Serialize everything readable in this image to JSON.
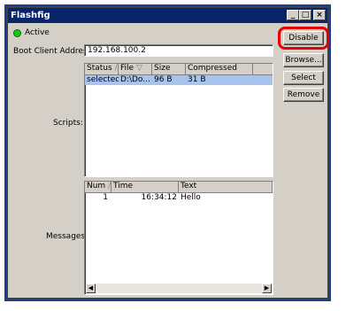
{
  "window": {
    "title": "Flashfig",
    "minimize_glyph": "_",
    "maximize_glyph": "□",
    "close_glyph": "×"
  },
  "status": {
    "label": "Active",
    "color": "#18c818"
  },
  "boot_client": {
    "label": "Boot Client Address:",
    "value": "192.168.100.2"
  },
  "scripts": {
    "label": "Scripts:",
    "columns": [
      "Status",
      "File",
      "Size",
      "Compressed"
    ],
    "rows": [
      {
        "status": "selected",
        "file": "D:\\Do...",
        "size": "96 B",
        "compressed": "31 B"
      }
    ]
  },
  "messages": {
    "label": "Messages:",
    "columns": [
      "Num",
      "Time",
      "Text"
    ],
    "rows": [
      {
        "num": "1",
        "time": "16:34:12",
        "text": "Hello"
      }
    ]
  },
  "buttons": {
    "disable": "Disable",
    "browse": "Browse...",
    "select": "Select",
    "remove": "Remove"
  },
  "colors": {
    "highlight": "#e00000",
    "selected_row": "#a8c4ec"
  }
}
